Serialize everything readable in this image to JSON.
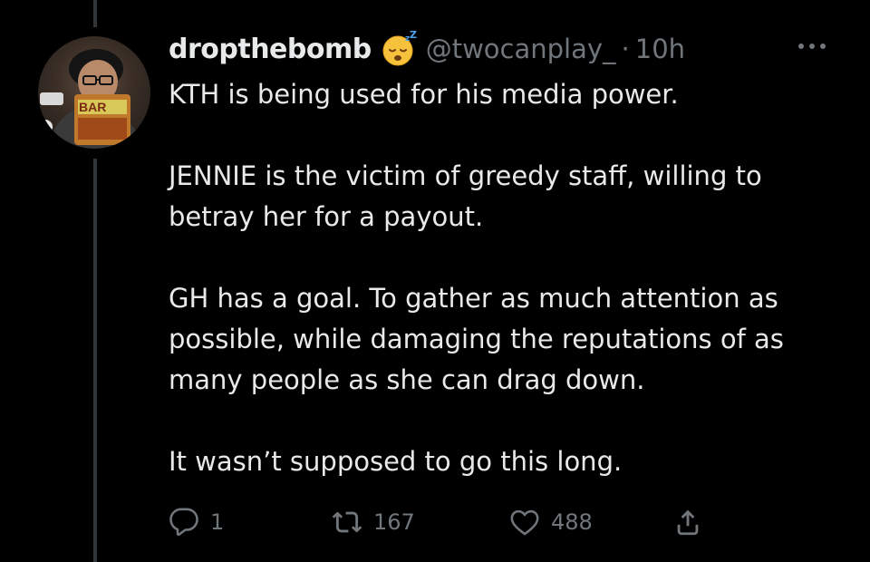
{
  "tweet": {
    "display_name": "dropthebomb",
    "emoji_icon": "sleeping-face-emoji",
    "handle": "@twocanplay_",
    "separator": "·",
    "time": "10h",
    "avatar_text": "BAR",
    "body": [
      "KTH is being used for his media power.",
      "JENNIE is the victim of greedy staff, willing to betray her for a payout.",
      "GH has a goal. To gather as much attention as possible, while damaging the reputations of as many people as she can drag down.",
      "It wasn’t supposed to go this long."
    ],
    "actions": {
      "reply": {
        "icon": "reply-icon",
        "count": "1"
      },
      "retweet": {
        "icon": "retweet-icon",
        "count": "167"
      },
      "like": {
        "icon": "heart-icon",
        "count": "488"
      },
      "share": {
        "icon": "share-icon"
      }
    }
  },
  "colors": {
    "background": "#000000",
    "primary_text": "#e7e9ea",
    "secondary_text": "#71767b",
    "thread_line": "#333639"
  }
}
